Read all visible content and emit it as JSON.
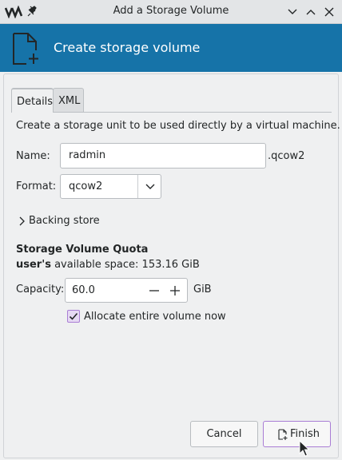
{
  "window": {
    "title": "Add a Storage Volume",
    "app_icon": "virt-manager-logo-icon",
    "pin_icon": "pin-icon",
    "controls": [
      "chevron-down-icon",
      "chevron-up-icon",
      "close-icon"
    ]
  },
  "header": {
    "icon": "new-file-icon",
    "title": "Create storage volume"
  },
  "tabs": [
    {
      "label": "Details",
      "active": true
    },
    {
      "label": "XML",
      "active": false
    }
  ],
  "details": {
    "description": "Create a storage unit to be used directly by a virtual machine.",
    "name_label": "Name:",
    "name_value": "radmin",
    "name_suffix": ".qcow2",
    "format_label": "Format:",
    "format_value": "qcow2",
    "backing_store_label": "Backing store",
    "quota_title": "Storage Volume Quota",
    "quota_user": "user's",
    "quota_space_text": " available space: 153.16 GiB",
    "capacity_label": "Capacity:",
    "capacity_value": "60.0",
    "capacity_unit": "GiB",
    "allocate_label": "Allocate entire volume now",
    "allocate_checked": true
  },
  "buttons": {
    "cancel": "Cancel",
    "finish": "Finish"
  },
  "colors": {
    "banner": "#1673a8",
    "accent": "#a97dd5"
  }
}
